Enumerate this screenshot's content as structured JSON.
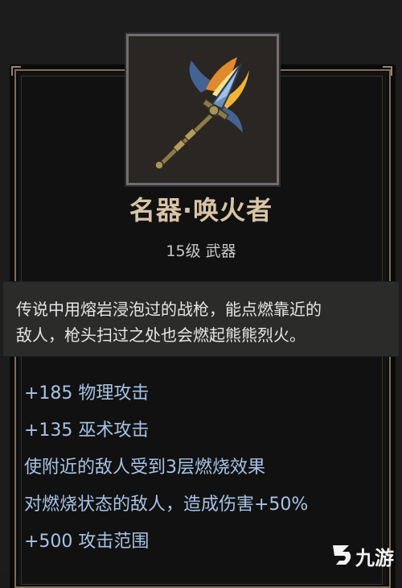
{
  "item": {
    "name": "名器·唤火者",
    "subtitle": "15级 武器",
    "description_lines": [
      "传说中用熔岩浸泡过的战枪，能点燃靠近的",
      "敌人，枪头扫过之处也会燃起熊熊烈火。"
    ],
    "stats": [
      "+185 物理攻击",
      "+135 巫术攻击",
      "使附近的敌人受到3层燃烧效果",
      "对燃烧状态的敌人，造成伤害+50%",
      "+500 攻击范围"
    ],
    "icon": "flaming-spear-icon"
  },
  "watermark": {
    "text": "九游",
    "logo": "jiuyou-logo-icon"
  },
  "colors": {
    "title": "#d9c4a6",
    "stat": "#a6c3e6",
    "frame": "#7d6e55",
    "description": "#e6e6e6",
    "subtitle": "#c9c9c9"
  }
}
